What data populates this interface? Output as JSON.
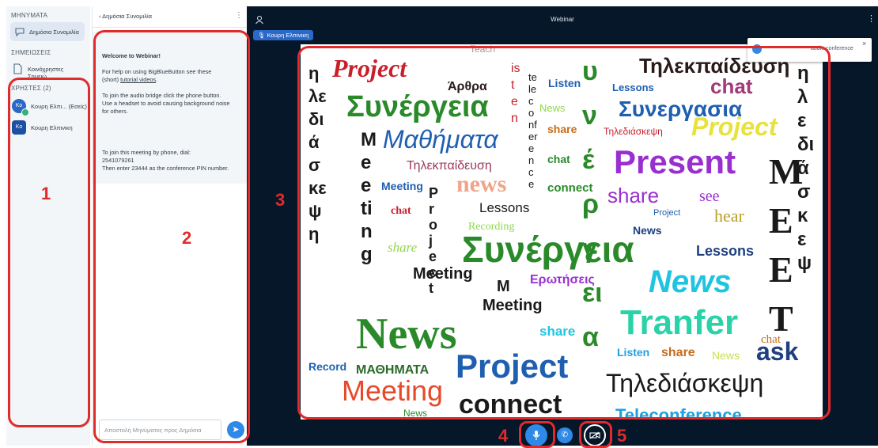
{
  "sidebar": {
    "messages_title": "ΜΗΝΥΜΑΤΑ",
    "public_chat_label": "Δημόσια Συνομιλία",
    "notes_title": "ΣΗΜΕΙΩΣΕΙΣ",
    "shared_notes_label": "Κοινόχρηστες Σημειώ...",
    "users_title": "ΧΡΗΣΤΕΣ (2)",
    "users": [
      {
        "initials": "Κο",
        "name": "Κουρη Ελπι... (Εσείς)",
        "color": "#2a69c7"
      },
      {
        "initials": "Κο",
        "name": "Κουρη Ελπινικη",
        "color": "#1d4fa3"
      }
    ]
  },
  "chat": {
    "title": "Δημόσια Συνομιλία",
    "welcome": "Welcome to Webinar!",
    "help_line1": "For help on using BigBlueButton see these",
    "help_line2_prefix": "(short) ",
    "help_link": "tutorial videos",
    "help_line2_suffix": ".",
    "audio_line1": "To join the audio bridge click the phone button.",
    "audio_line2": "Use a headset to avoid causing background noise",
    "audio_line3": "for others.",
    "phone_line1": "To join this meeting by phone, dial:",
    "phone_number": "2541079261",
    "phone_line3": "Then enter 23444 as the conference PIN number.",
    "input_placeholder": "Αποστολή Μηνύματος προς Δημόσια"
  },
  "main": {
    "title": "Webinar",
    "presenter_name": "Κουρη Ελπινικη",
    "toast_text": "audio conference"
  },
  "slide_words": {
    "project_red": "Project",
    "teleschool_top": "Τηλεκπαίδευση",
    "arthra": "Άρθρα",
    "listen": "Listen",
    "lessons_top": "Lessons",
    "chat_top": "chat",
    "synergeia_top": "Συνέργεια",
    "news_small": "News",
    "synergasia": "Συνεργασια",
    "mathimata": "Μαθήματα",
    "share_top": "share",
    "tilediaskepsi_small": "Τηλεδιάσκεψη",
    "project_yellow": "Project",
    "teleschool_mid": "Τηλεκπαίδευση",
    "chat_green": "chat",
    "present": "Present",
    "meeting_blue": "Meeting",
    "news_orange": "news",
    "connect_green": "connect",
    "share_mid": "share",
    "see": "see",
    "chat_red": "chat",
    "lessons_mid": "Lessons",
    "project_small": "Project",
    "hear": "hear",
    "recording": "Recording",
    "news_navy": "News",
    "share_green": "share",
    "synergeia_big": "Συνέργεια",
    "lessons_blue": "Lessons",
    "meeting_black": "Meeting",
    "m_letter": "M",
    "erotiseis": "Ερωτήσεις",
    "news_cyan": "News",
    "meeting_black2": "Meeting",
    "news_big": "News",
    "share_cyan": "share",
    "tranfer": "Tranfer",
    "chat_orange": "chat",
    "listen_blue": "Listen",
    "share_orange": "share",
    "news_lime": "News",
    "ask": "ask",
    "record": "Record",
    "mathimata_caps": "ΜΑΘΗΜΑΤΑ",
    "project_big": "Project",
    "tilediaskepsi_big": "Τηλεδιάσκεψη",
    "meeting_red": "Meeting",
    "connect_big": "connect",
    "news_bottom": "News",
    "teleconference": "Teleconference",
    "teach": "Teach",
    "left_vertical": "ηλεδιάσκεψη",
    "right_vertical": "ηλεδιάσκεψ",
    "teleconference_vertical": "teleconference",
    "meet_vertical": "MEET",
    "project_vertical": "Project",
    "meeting_vertical": "Meeting",
    "eisti_vertical": "isten",
    "synergeia_vertical": "υνέργεια"
  },
  "annotations": [
    "1",
    "2",
    "3",
    "4",
    "5"
  ],
  "colors": {
    "main_bg": "#06172a",
    "accent_blue": "#2e8ae6",
    "annotation_red": "#e02b2b"
  }
}
